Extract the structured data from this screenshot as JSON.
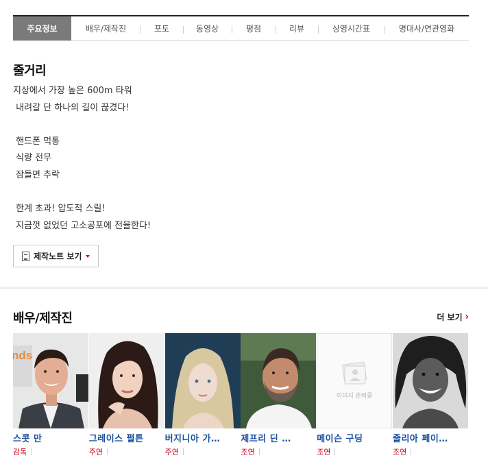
{
  "tabs": [
    "주요정보",
    "배우/제작진",
    "포토",
    "동영상",
    "평점",
    "리뷰",
    "상영시간표",
    "명대사/연관영화"
  ],
  "synopsis": {
    "title": "줄거리",
    "lines": [
      "지상에서 가장 높은 600m 타워",
      " 내려갈 단 하나의 길이 끊겼다!",
      "",
      " 핸드폰 먹통",
      " 식량 전무",
      " 잠들면 추락",
      "",
      " 한계 초과! 압도적 스릴!",
      " 지금껏 없었던 고소공포에 전율한다!"
    ],
    "note_button": "제작노트 보기"
  },
  "cast_section": {
    "title": "배우/제작진",
    "more": "더 보기",
    "members": [
      {
        "name": "스콧 만",
        "role": "감독",
        "photo": "man-dark-hair-smiling"
      },
      {
        "name": "그레이스 펄튼",
        "role": "주연",
        "photo": "woman-dark-hair"
      },
      {
        "name": "버지니아 가…",
        "role": "주연",
        "photo": "woman-blonde"
      },
      {
        "name": "제프리 딘 …",
        "role": "조연",
        "photo": "man-bearded-smiling"
      },
      {
        "name": "메이슨 구딩",
        "role": "조연",
        "photo": "image-placeholder",
        "placeholder_text": "이미지 준비중"
      },
      {
        "name": "줄리아 페이…",
        "role": "조연",
        "photo": "woman-curly-hair-bw"
      }
    ]
  },
  "colors": {
    "accent_red": "#d0021b",
    "name_blue": "#1a4fa0",
    "active_tab": "#7a7a7a"
  }
}
